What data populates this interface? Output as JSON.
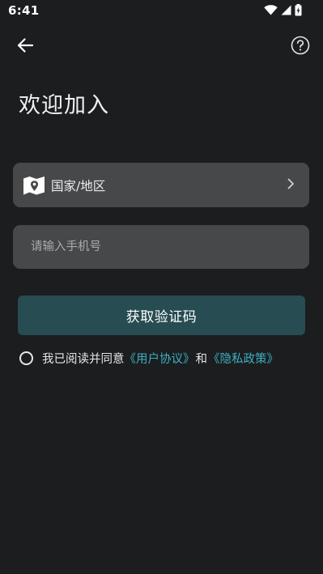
{
  "status_bar": {
    "time": "6:41",
    "icons": [
      "wifi-icon",
      "signal-icon",
      "battery-icon"
    ]
  },
  "app_bar": {
    "back_icon": "arrow-left-icon",
    "help_icon": "help-circle-icon"
  },
  "title": "欢迎加入",
  "country": {
    "icon": "map-pin-icon",
    "label": "国家/地区",
    "chevron_icon": "chevron-right-icon"
  },
  "phone": {
    "placeholder": "请输入手机号",
    "value": ""
  },
  "get_code_button": "获取验证码",
  "agreement": {
    "checked": false,
    "prefix": "我已阅读并同意",
    "user_agreement": "《用户协议》",
    "conjunction": "和",
    "privacy_policy": "《隐私政策》"
  },
  "colors": {
    "background": "#1b1d1e",
    "field_background": "#474849",
    "button_background": "#274c52",
    "link": "#3fb0c4",
    "text": "#e8e8e8"
  }
}
